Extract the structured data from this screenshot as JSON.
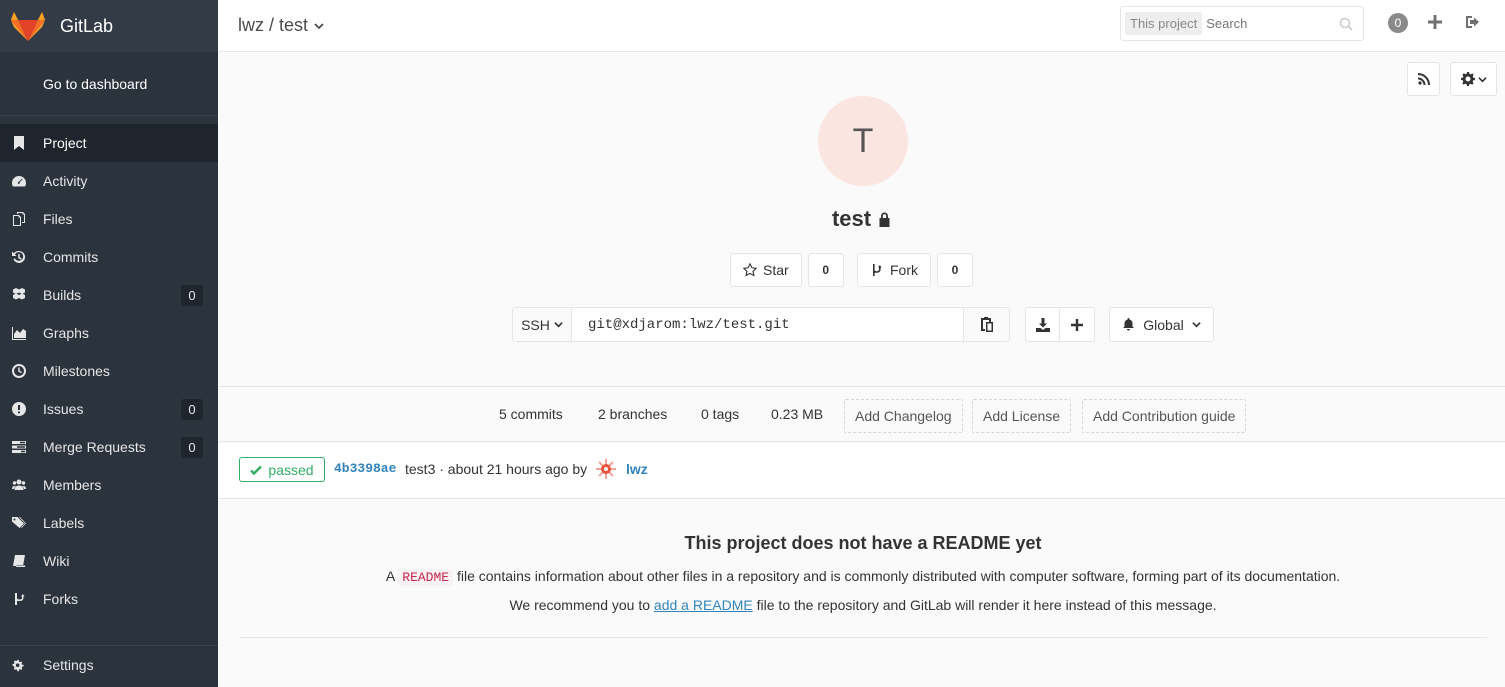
{
  "brand": {
    "name": "GitLab",
    "icon": "fox-logo"
  },
  "sidebar": {
    "dashboard_label": "Go to dashboard",
    "items": [
      {
        "label": "Project",
        "icon": "bookmark-icon",
        "active": true
      },
      {
        "label": "Activity",
        "icon": "dashboard-icon"
      },
      {
        "label": "Files",
        "icon": "files-icon"
      },
      {
        "label": "Commits",
        "icon": "history-icon"
      },
      {
        "label": "Builds",
        "icon": "cubes-icon",
        "badge": "0"
      },
      {
        "label": "Graphs",
        "icon": "area-chart-icon"
      },
      {
        "label": "Milestones",
        "icon": "clock-icon"
      },
      {
        "label": "Issues",
        "icon": "exclamation-circle-icon",
        "badge": "0"
      },
      {
        "label": "Merge Requests",
        "icon": "tasks-icon",
        "badge": "0"
      },
      {
        "label": "Members",
        "icon": "users-icon"
      },
      {
        "label": "Labels",
        "icon": "tags-icon"
      },
      {
        "label": "Wiki",
        "icon": "book-icon"
      },
      {
        "label": "Forks",
        "icon": "code-fork-icon"
      }
    ],
    "settings_label": "Settings"
  },
  "header": {
    "title": "lwz / test",
    "search_scope": "This project",
    "search_placeholder": "Search",
    "todo_count": "0"
  },
  "project": {
    "avatar_letter": "T",
    "name": "test",
    "star_label": "Star",
    "star_count": "0",
    "fork_label": "Fork",
    "fork_count": "0",
    "clone_protocol": "SSH",
    "clone_url": "git@xdjarom:lwz/test.git",
    "notification_level": "Global"
  },
  "stats": {
    "commits": "5 commits",
    "branches": "2 branches",
    "tags": "0 tags",
    "size": "0.23 MB",
    "add_changelog": "Add Changelog",
    "add_license": "Add License",
    "add_contribution": "Add Contribution guide"
  },
  "last_commit": {
    "status": "passed",
    "sha": "4b3398ae",
    "message": "test3 · about 21 hours ago by",
    "author": "lwz"
  },
  "readme": {
    "title": "This project does not have a README yet",
    "p1_prefix": "A",
    "p1_code": "README",
    "p1_suffix": "file contains information about other files in a repository and is commonly distributed with computer software, forming part of its documentation.",
    "p2_prefix": "We recommend you to",
    "p2_link": "add a README",
    "p2_suffix": "file to the repository and GitLab will render it here instead of this message."
  },
  "colors": {
    "sidebar_bg": "#2b333d",
    "ci_passed": "#31af64",
    "link": "#3084bb",
    "avatar_bg": "#fbe5e1"
  }
}
